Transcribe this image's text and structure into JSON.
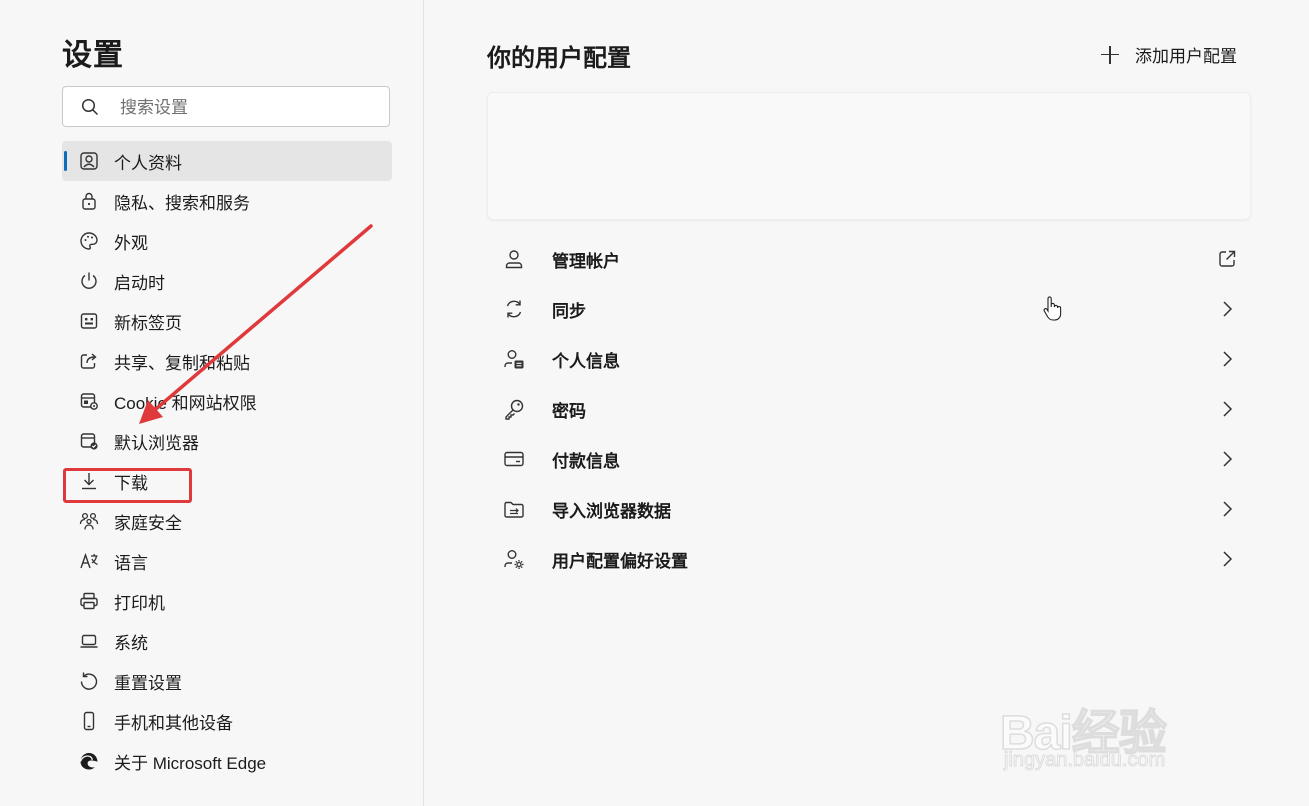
{
  "sidebar": {
    "title": "设置",
    "search_placeholder": "搜索设置",
    "items": [
      {
        "label": "个人资料",
        "icon": "profile-icon",
        "active": true
      },
      {
        "label": "隐私、搜索和服务",
        "icon": "lock-icon"
      },
      {
        "label": "外观",
        "icon": "palette-icon"
      },
      {
        "label": "启动时",
        "icon": "power-icon"
      },
      {
        "label": "新标签页",
        "icon": "new-tab-icon"
      },
      {
        "label": "共享、复制和粘贴",
        "icon": "share-icon"
      },
      {
        "label": "Cookie 和网站权限",
        "icon": "site-permissions-icon"
      },
      {
        "label": "默认浏览器",
        "icon": "default-browser-icon"
      },
      {
        "label": "下载",
        "icon": "download-icon"
      },
      {
        "label": "家庭安全",
        "icon": "family-icon"
      },
      {
        "label": "语言",
        "icon": "language-icon"
      },
      {
        "label": "打印机",
        "icon": "printer-icon"
      },
      {
        "label": "系统",
        "icon": "laptop-icon"
      },
      {
        "label": "重置设置",
        "icon": "reset-icon"
      },
      {
        "label": "手机和其他设备",
        "icon": "phone-icon"
      },
      {
        "label": "关于 Microsoft Edge",
        "icon": "edge-logo-icon"
      }
    ]
  },
  "main": {
    "title": "你的用户配置",
    "add_profile_label": "添加用户配置",
    "rows": [
      {
        "label": "管理帐户",
        "icon": "account-icon",
        "end_icon": "external-link-icon"
      },
      {
        "label": "同步",
        "icon": "sync-icon",
        "end_icon": "chevron-right-icon"
      },
      {
        "label": "个人信息",
        "icon": "personal-info-icon",
        "end_icon": "chevron-right-icon"
      },
      {
        "label": "密码",
        "icon": "key-icon",
        "end_icon": "chevron-right-icon"
      },
      {
        "label": "付款信息",
        "icon": "card-icon",
        "end_icon": "chevron-right-icon"
      },
      {
        "label": "导入浏览器数据",
        "icon": "import-icon",
        "end_icon": "chevron-right-icon"
      },
      {
        "label": "用户配置偏好设置",
        "icon": "profile-settings-icon",
        "end_icon": "chevron-right-icon"
      }
    ]
  },
  "watermark": {
    "text": "Bai经验",
    "url": "jingyan.baidu.com"
  },
  "colors": {
    "accent": "#0f6cbd",
    "annotation": "#e0393b",
    "background": "#f7f7f7"
  }
}
